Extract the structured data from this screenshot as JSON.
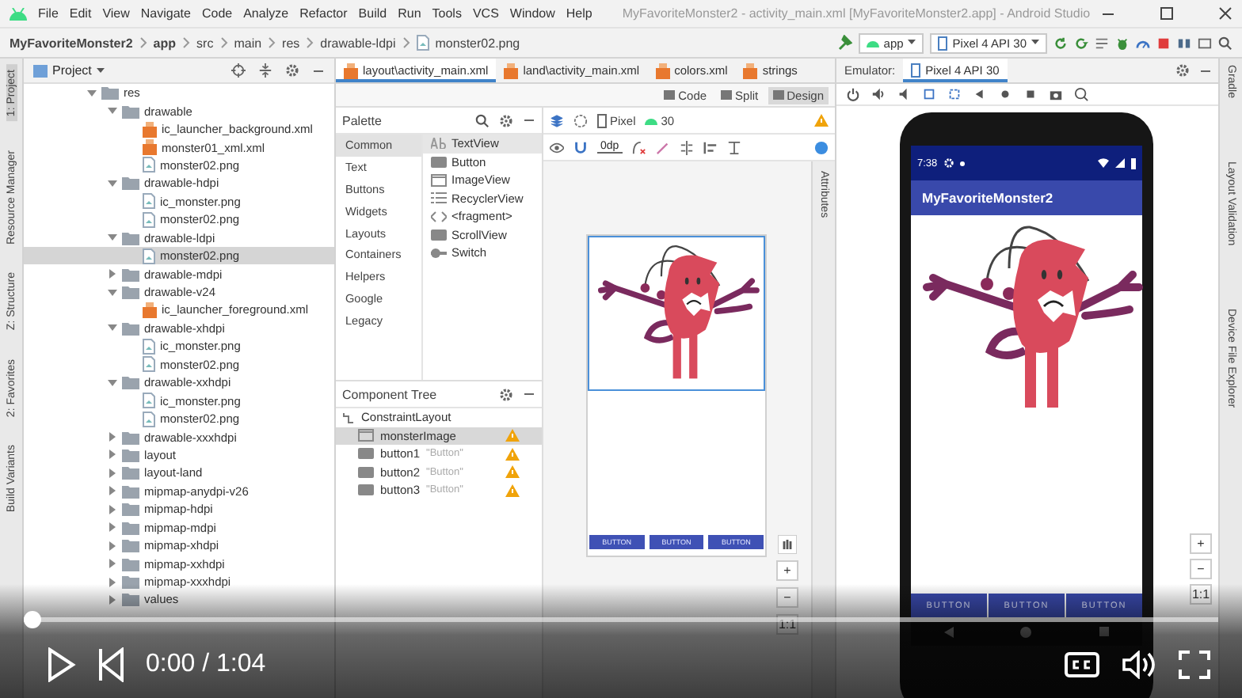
{
  "window": {
    "title": "MyFavoriteMonster2 - activity_main.xml [MyFavoriteMonster2.app] - Android Studio"
  },
  "menu": [
    "File",
    "Edit",
    "View",
    "Navigate",
    "Code",
    "Analyze",
    "Refactor",
    "Build",
    "Run",
    "Tools",
    "VCS",
    "Window",
    "Help"
  ],
  "breadcrumb": [
    "MyFavoriteMonster2",
    "app",
    "src",
    "main",
    "res",
    "drawable-ldpi",
    "monster02.png"
  ],
  "toolbar": {
    "run_config": "app",
    "device": "Pixel 4 API 30"
  },
  "left_strip": [
    {
      "label": "1: Project",
      "selected": true
    },
    {
      "label": "Resource Manager",
      "selected": false
    },
    {
      "label": "Z: Structure",
      "selected": false
    },
    {
      "label": "2: Favorites",
      "selected": false
    },
    {
      "label": "Build Variants",
      "selected": false
    }
  ],
  "project": {
    "title": "Project",
    "tree": [
      {
        "label": "res",
        "kind": "folder",
        "expanded": true,
        "selected": false,
        "children": [
          {
            "label": "drawable",
            "kind": "folder",
            "expanded": true,
            "selected": false,
            "children": [
              {
                "label": "ic_launcher_background.xml",
                "kind": "xml",
                "selected": false
              },
              {
                "label": "monster01_xml.xml",
                "kind": "xml",
                "selected": false
              },
              {
                "label": "monster02.png",
                "kind": "png",
                "selected": false
              }
            ]
          },
          {
            "label": "drawable-hdpi",
            "kind": "folder",
            "expanded": true,
            "selected": false,
            "children": [
              {
                "label": "ic_monster.png",
                "kind": "png",
                "selected": false
              },
              {
                "label": "monster02.png",
                "kind": "png",
                "selected": false
              }
            ]
          },
          {
            "label": "drawable-ldpi",
            "kind": "folder",
            "expanded": true,
            "selected": false,
            "children": [
              {
                "label": "monster02.png",
                "kind": "png",
                "selected": true
              }
            ]
          },
          {
            "label": "drawable-mdpi",
            "kind": "folder",
            "expanded": false,
            "selected": false
          },
          {
            "label": "drawable-v24",
            "kind": "folder",
            "expanded": true,
            "selected": false,
            "children": [
              {
                "label": "ic_launcher_foreground.xml",
                "kind": "xml",
                "selected": false
              }
            ]
          },
          {
            "label": "drawable-xhdpi",
            "kind": "folder",
            "expanded": true,
            "selected": false,
            "children": [
              {
                "label": "ic_monster.png",
                "kind": "png",
                "selected": false
              },
              {
                "label": "monster02.png",
                "kind": "png",
                "selected": false
              }
            ]
          },
          {
            "label": "drawable-xxhdpi",
            "kind": "folder",
            "expanded": true,
            "selected": false,
            "children": [
              {
                "label": "ic_monster.png",
                "kind": "png",
                "selected": false
              },
              {
                "label": "monster02.png",
                "kind": "png",
                "selected": false
              }
            ]
          },
          {
            "label": "drawable-xxxhdpi",
            "kind": "folder",
            "expanded": false,
            "selected": false
          },
          {
            "label": "layout",
            "kind": "folder",
            "expanded": false,
            "selected": false
          },
          {
            "label": "layout-land",
            "kind": "folder",
            "expanded": false,
            "selected": false
          },
          {
            "label": "mipmap-anydpi-v26",
            "kind": "folder",
            "expanded": false,
            "selected": false
          },
          {
            "label": "mipmap-hdpi",
            "kind": "folder",
            "expanded": false,
            "selected": false
          },
          {
            "label": "mipmap-mdpi",
            "kind": "folder",
            "expanded": false,
            "selected": false
          },
          {
            "label": "mipmap-xhdpi",
            "kind": "folder",
            "expanded": false,
            "selected": false
          },
          {
            "label": "mipmap-xxhdpi",
            "kind": "folder",
            "expanded": false,
            "selected": false
          },
          {
            "label": "mipmap-xxxhdpi",
            "kind": "folder",
            "expanded": false,
            "selected": false
          },
          {
            "label": "values",
            "kind": "folder",
            "expanded": false,
            "selected": false
          }
        ]
      }
    ]
  },
  "editor": {
    "tabs": [
      {
        "label": "layout\\activity_main.xml",
        "selected": true
      },
      {
        "label": "land\\activity_main.xml",
        "selected": false
      },
      {
        "label": "colors.xml",
        "selected": false
      },
      {
        "label": "strings",
        "selected": false
      }
    ],
    "modes": [
      {
        "label": "Code",
        "selected": false
      },
      {
        "label": "Split",
        "selected": false
      },
      {
        "label": "Design",
        "selected": true
      }
    ],
    "palette": {
      "title": "Palette",
      "categories": [
        {
          "label": "Common",
          "selected": true
        },
        {
          "label": "Text",
          "selected": false
        },
        {
          "label": "Buttons",
          "selected": false
        },
        {
          "label": "Widgets",
          "selected": false
        },
        {
          "label": "Layouts",
          "selected": false
        },
        {
          "label": "Containers",
          "selected": false
        },
        {
          "label": "Helpers",
          "selected": false
        },
        {
          "label": "Google",
          "selected": false
        },
        {
          "label": "Legacy",
          "selected": false
        }
      ],
      "items": [
        {
          "label": "TextView",
          "kind": "text",
          "selected": true
        },
        {
          "label": "Button",
          "kind": "button",
          "selected": false
        },
        {
          "label": "ImageView",
          "kind": "image",
          "selected": false
        },
        {
          "label": "RecyclerView",
          "kind": "list",
          "selected": false
        },
        {
          "label": "<fragment>",
          "kind": "fragment",
          "selected": false
        },
        {
          "label": "ScrollView",
          "kind": "button",
          "selected": false
        },
        {
          "label": "Switch",
          "kind": "switch",
          "selected": false
        }
      ]
    },
    "component_tree": {
      "title": "Component Tree",
      "root": "ConstraintLayout",
      "children": [
        {
          "label": "monsterImage",
          "kind": "image",
          "selected": true,
          "warning": true
        },
        {
          "label": "button1",
          "hint": "\"Button\"",
          "kind": "button",
          "selected": false,
          "warning": true
        },
        {
          "label": "button2",
          "hint": "\"Button\"",
          "kind": "button",
          "selected": false,
          "warning": true
        },
        {
          "label": "button3",
          "hint": "\"Button\"",
          "kind": "button",
          "selected": false,
          "warning": true
        }
      ]
    },
    "design_toolbar": {
      "device": "Pixel",
      "api": "30",
      "margin": "0dp"
    },
    "blueprint": {
      "buttons": [
        "BUTTON",
        "BUTTON",
        "BUTTON"
      ]
    },
    "zoom": [
      "+",
      "−",
      "1:1"
    ],
    "attributes_label": "Attributes"
  },
  "emulator": {
    "label": "Emulator:",
    "tabs": [
      {
        "label": "Pixel 4 API 30",
        "selected": true
      }
    ],
    "phone": {
      "time": "7:38",
      "app_title": "MyFavoriteMonster2",
      "buttons": [
        "BUTTON",
        "BUTTON",
        "BUTTON"
      ]
    },
    "zoom": [
      "+",
      "−",
      "1:1"
    ]
  },
  "right_strip": [
    "Gradle",
    "Layout Validation",
    "Device File Explorer"
  ],
  "video": {
    "level": 0,
    "time": "0:00 / 1:04"
  }
}
